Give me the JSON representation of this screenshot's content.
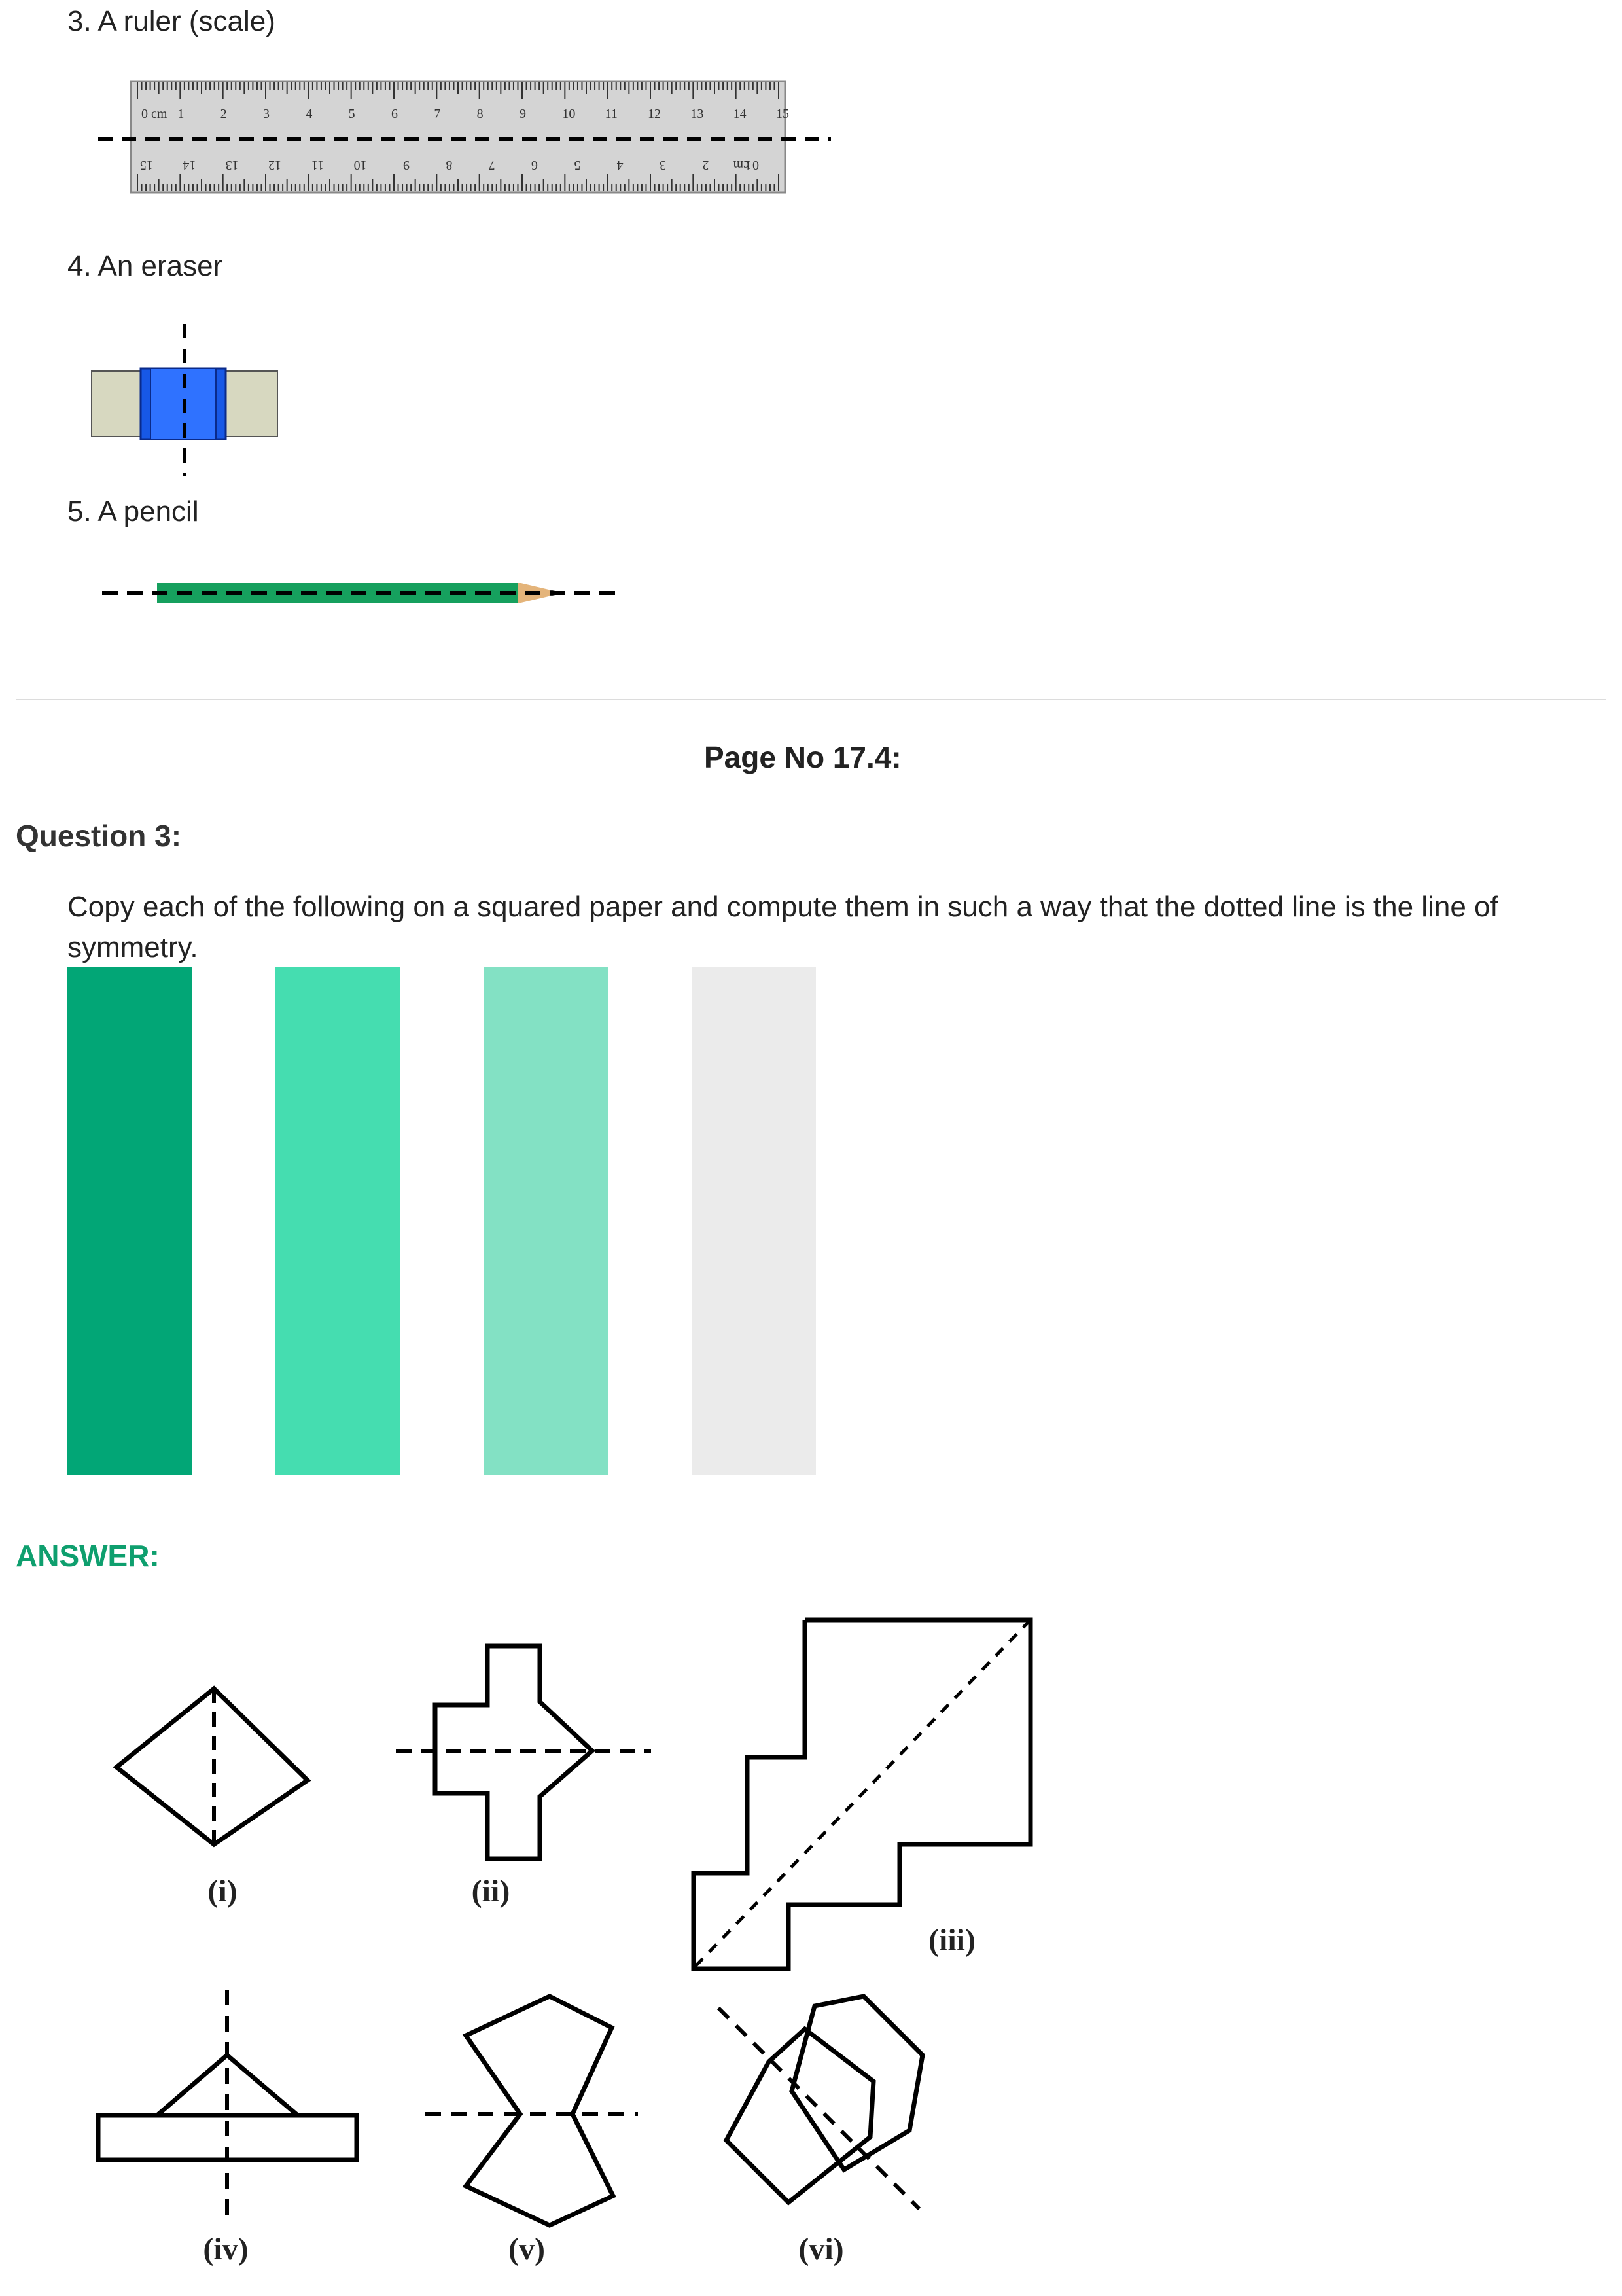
{
  "items": [
    {
      "label": "3. A ruler (scale)"
    },
    {
      "label": "4. An eraser"
    },
    {
      "label": "5. A pencil"
    }
  ],
  "ruler": {
    "top_numbers": [
      "0 cm",
      "1",
      "2",
      "3",
      "4",
      "5",
      "6",
      "7",
      "8",
      "9",
      "10",
      "11",
      "12",
      "13",
      "14",
      "15"
    ],
    "bottom_numbers": [
      "15",
      "14",
      "13",
      "12",
      "11",
      "10",
      "9",
      "8",
      "7",
      "6",
      "5",
      "4",
      "3",
      "2",
      "1",
      "0 cm"
    ]
  },
  "page_heading": "Page No 17.4:",
  "question": {
    "title": "Question 3:",
    "text": "Copy each of the following on a squared paper and compute them in such a way that the dotted line is the line of symmetry."
  },
  "color_bars": [
    {
      "color": "#02a676"
    },
    {
      "color": "#45ddb0"
    },
    {
      "color": "#83e1c4"
    },
    {
      "color": "#ebebeb"
    }
  ],
  "answer_label": "ANSWER:",
  "figure_labels": [
    "(i)",
    "(ii)",
    "(iii)",
    "(iv)",
    "(v)",
    "(vi)"
  ]
}
